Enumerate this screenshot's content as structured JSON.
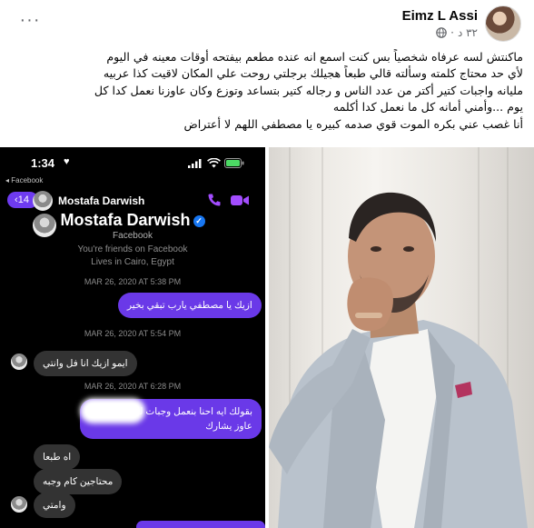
{
  "post": {
    "author": "Eimz L Assi",
    "time": "٣٢ د",
    "separator": "·",
    "privacy_icon": "globe-icon",
    "more_label": "···",
    "text_lines": [
      "ماكنتش لسه عرفاه شخصياً بس كنت اسمع انه عنده مطعم بيفتحه أوقات معينه في اليوم",
      "لأي حد محتاج كلمته وسألته قالي طبعاً هجيلك برجلتي روحت علي المكان لاقيت كذا عربيه",
      "مليانه واجبات كتير أكتر من عدد الناس و رجاله كتير بتساعد وتوزع وكان عاوزنا نعمل كدا كل",
      "يوم ...وأمني أمانه كل ما نعمل كدا أكلمه",
      "أنا غصب عني بكره الموت قوي صدمه كبيره يا مصطفي اللهم لا أعتراض"
    ]
  },
  "screenshot": {
    "status_time": "1:34",
    "status_heart": "♥",
    "back_app": "◂ Facebook",
    "back_badge": "‹14",
    "contact_name": "Mostafa Darwish",
    "profile_name": "Mostafa Darwish",
    "verified_mark": "✓",
    "profile_platform": "Facebook",
    "profile_friends": "You're friends on Facebook",
    "profile_location": "Lives in Cairo, Egypt",
    "dates": [
      "MAR 26, 2020 AT 5:38 PM",
      "MAR 26, 2020 AT 5:54 PM",
      "MAR 26, 2020 AT 6:28 PM"
    ],
    "messages": [
      {
        "text": "ازيك يا مصطفي يارب تبقي بخير"
      },
      {
        "text": "ايمو ازيك انا فل وانتي"
      },
      {
        "text": "بقولك ايه احنا بنعمل وجبات لو تعرف حد عاوز يشارك"
      },
      {
        "text": "اه طبعا"
      },
      {
        "text": "محتاجين كام وجبه"
      },
      {
        "text": "وامتي"
      }
    ],
    "colors": {
      "sent_bubble": "#6a39e8",
      "received_bubble": "#333333",
      "badge": "#6e3bf0"
    }
  }
}
